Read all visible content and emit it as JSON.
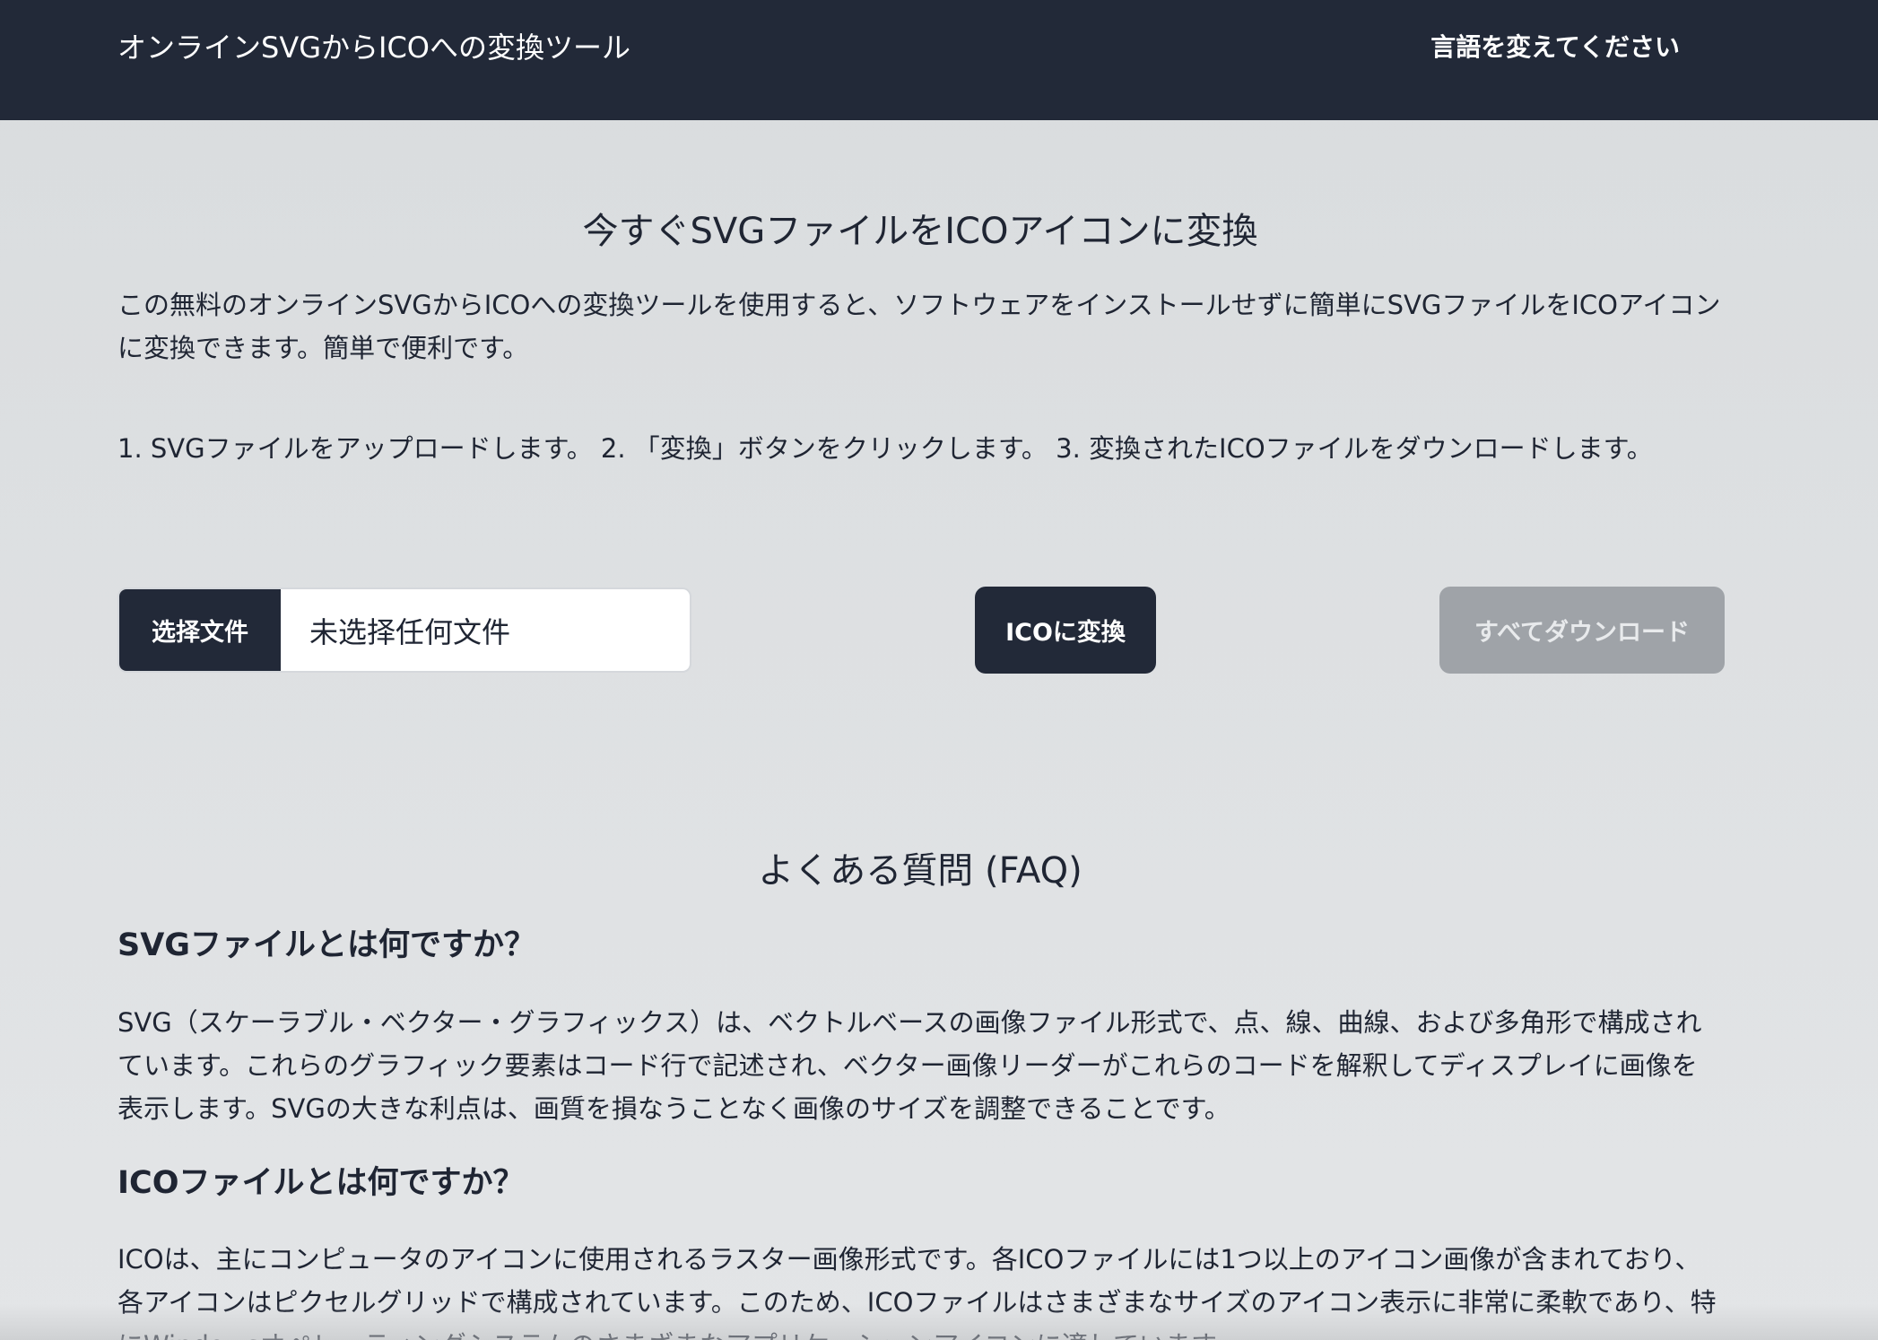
{
  "header": {
    "title": "オンラインSVGからICOへの変換ツール",
    "language_link": "言語を変えてください"
  },
  "hero": {
    "title": "今すぐSVGファイルをICOアイコンに変換",
    "intro": "この無料のオンラインSVGからICOへの変換ツールを使用すると、ソフトウェアをインストールせずに簡単にSVGファイルをICOアイコンに変換できます。簡単で便利です。",
    "steps": "1. SVGファイルをアップロードします。 2. 「変換」ボタンをクリックします。 3. 変換されたICOファイルをダウンロードします。"
  },
  "controls": {
    "file_button_label": "选择文件",
    "file_status": "未选择任何文件",
    "convert_label": "ICOに変換",
    "download_all_label": "すべてダウンロード"
  },
  "faq": {
    "title": "よくある質問 (FAQ)",
    "items": [
      {
        "question": "SVGファイルとは何ですか？",
        "answer": "SVG（スケーラブル・ベクター・グラフィックス）は、ベクトルベースの画像ファイル形式で、点、線、曲線、および多角形で構成されています。これらのグラフィック要素はコード行で記述され、ベクター画像リーダーがこれらのコードを解釈してディスプレイに画像を表示します。SVGの大きな利点は、画質を損なうことなく画像のサイズを調整できることです。"
      },
      {
        "question": "ICOファイルとは何ですか？",
        "answer": "ICOは、主にコンピュータのアイコンに使用されるラスター画像形式です。各ICOファイルには1つ以上のアイコン画像が含まれており、各アイコンはピクセルグリッドで構成されています。このため、ICOファイルはさまざまなサイズのアイコン表示に非常に柔軟であり、特にWindowsオペレーティングシステムのさまざまなアプリケーションアイコンに適しています。"
      }
    ]
  }
}
